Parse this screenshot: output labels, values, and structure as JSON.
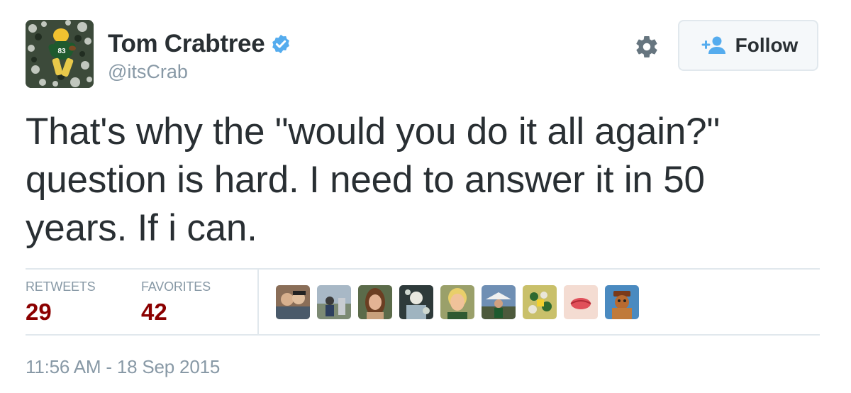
{
  "user": {
    "full_name": "Tom Crabtree",
    "handle": "@itsCrab",
    "verified_icon": "verified-badge-icon",
    "avatar_icon": "profile-avatar"
  },
  "actions": {
    "settings_icon": "gear-icon",
    "follow_label": "Follow",
    "follow_icon": "add-user-icon"
  },
  "tweet": {
    "line1": "That's why the \"would you do it all again?\"",
    "line2": "question is hard. I need to answer it in 50",
    "line3": "years. If i can."
  },
  "stats": {
    "retweets_label": "RETWEETS",
    "retweets_count": "29",
    "favorites_label": "FAVORITES",
    "favorites_count": "42"
  },
  "favoriters": [
    "favoriter-avatar",
    "favoriter-avatar",
    "favoriter-avatar",
    "favoriter-avatar",
    "favoriter-avatar",
    "favoriter-avatar",
    "favoriter-avatar",
    "favoriter-avatar",
    "favoriter-avatar"
  ],
  "timestamp": "11:56 AM - 18 Sep 2015",
  "colors": {
    "count_color": "#8b0000",
    "verified_blue": "#55acee",
    "muted_text": "#8899a6",
    "divider": "#e1e8ed"
  }
}
